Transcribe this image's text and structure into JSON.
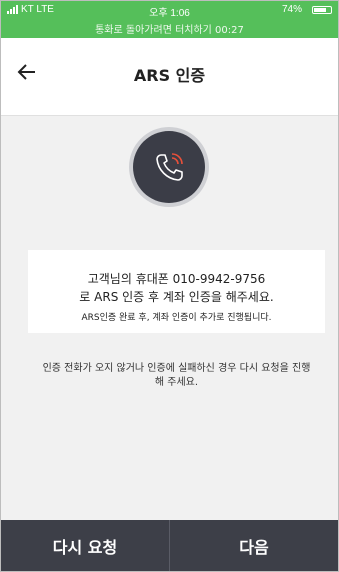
{
  "status_bar": {
    "carrier": "KT  LTE",
    "time": "오후 1:06",
    "right": "74%",
    "call_banner": "통화로 돌아가려면 터치하기 00:27"
  },
  "header": {
    "title": "ARS 인증"
  },
  "message": {
    "line1": "고객님의 휴대폰 010-9942-9756",
    "line2": "로 ARS 인증 후 계좌 인증을 해주세요.",
    "line3": "ARS인증 완료 후, 계좌 인증이 추가로 진행됩니다."
  },
  "note": {
    "line1": "인증 전화가 오지 않거나 인증에 실패하신 경우 다시 요청을 진행",
    "line2": "해 주세요."
  },
  "footer": {
    "retry_label": "다시 요청",
    "next_label": "다음"
  },
  "colors": {
    "status_green": "#55bf5a",
    "button_dark": "#3d3f48",
    "phone_accent": "#e8503a"
  }
}
